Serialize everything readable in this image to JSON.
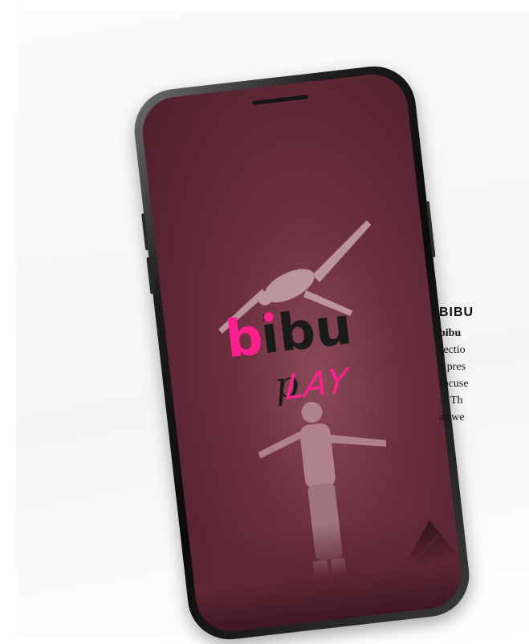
{
  "app": {
    "logo_word": "bibu",
    "logo_sub": "PLAY"
  },
  "colors": {
    "brand_pink": "#ff1f8e",
    "logo_dark": "#1a1a1a",
    "screen_tint": "#6b2e3e"
  },
  "article": {
    "heading": "BIBU",
    "lines": [
      "bibu",
      "sectio",
      "a pres",
      "focuse",
      "Th",
      "as we"
    ]
  }
}
